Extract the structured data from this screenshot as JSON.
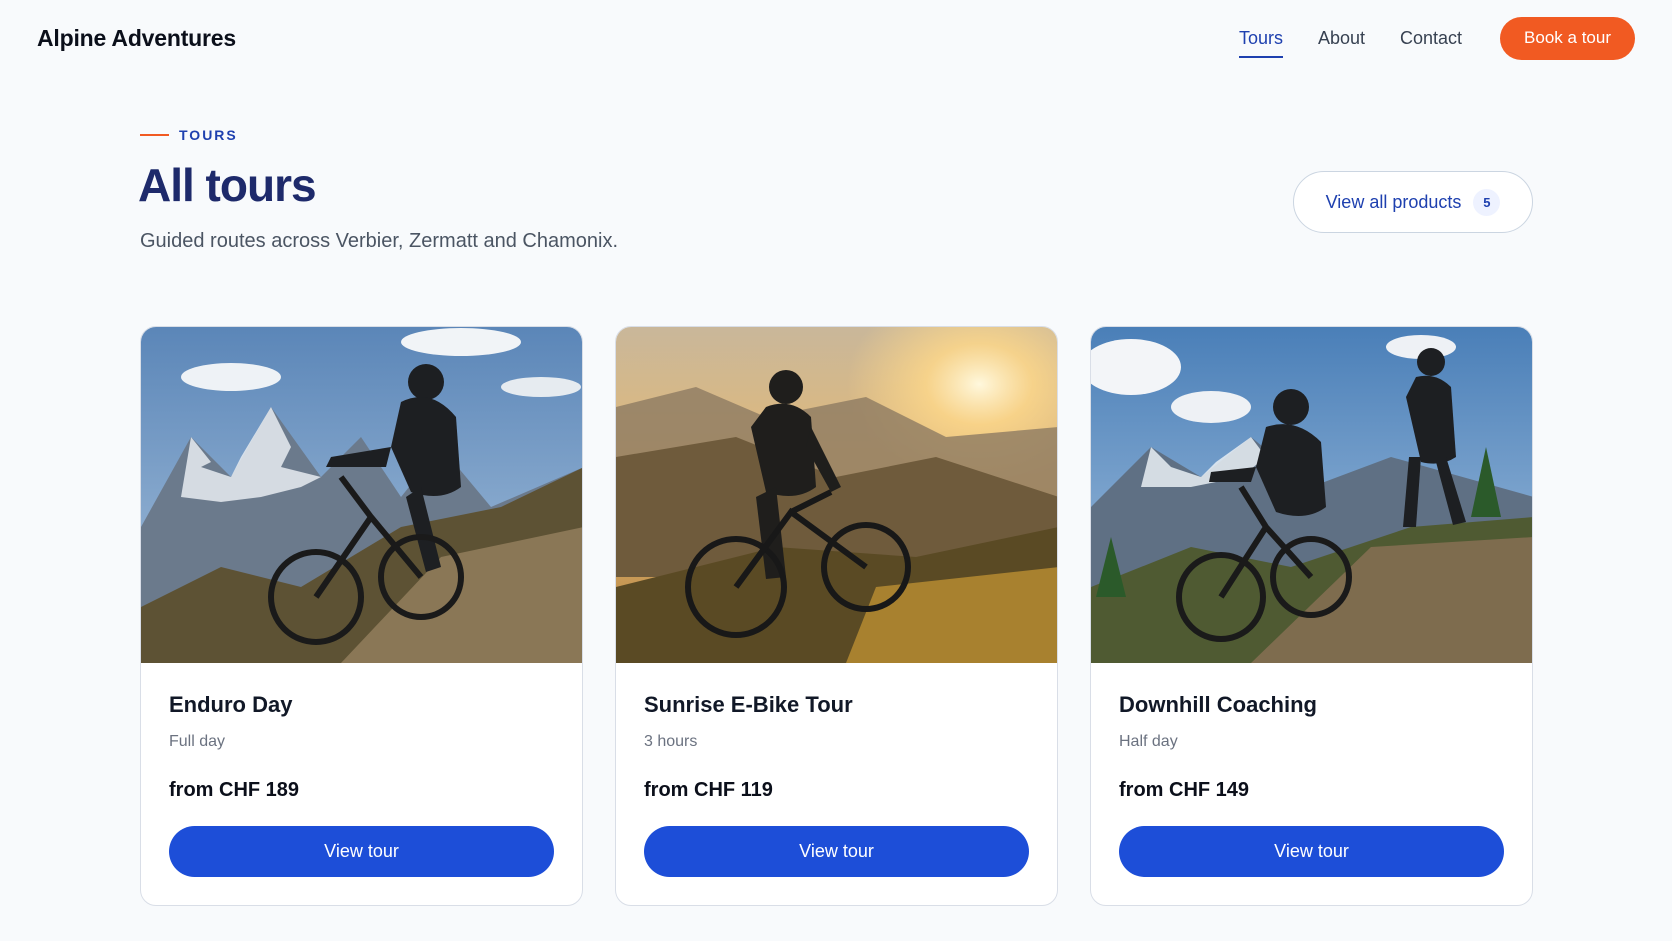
{
  "header": {
    "logo": "Alpine Adventures",
    "nav": [
      {
        "label": "Tours",
        "active": true
      },
      {
        "label": "About",
        "active": false
      },
      {
        "label": "Contact",
        "active": false
      }
    ],
    "cta_label": "Book a tour"
  },
  "section": {
    "eyebrow": "TOURS",
    "title": "All tours",
    "subtitle": "Guided routes across Verbier, Zermatt and Chamonix.",
    "view_all_label": "View all products",
    "view_all_count": "5"
  },
  "tours": [
    {
      "title": "Enduro Day",
      "duration": "Full day",
      "price": "from CHF 189",
      "button": "View tour",
      "image": "mountain-biker-alpine-trail"
    },
    {
      "title": "Sunrise E-Bike Tour",
      "duration": "3 hours",
      "price": "from CHF 119",
      "button": "View tour",
      "image": "e-bike-rider-sunrise-valley"
    },
    {
      "title": "Downhill Coaching",
      "duration": "Half day",
      "price": "from CHF 149",
      "button": "View tour",
      "image": "downhill-coach-and-rider"
    }
  ],
  "colors": {
    "accent_orange": "#f15a22",
    "primary_blue": "#1d4ed8",
    "title_navy": "#1e2a6b"
  }
}
